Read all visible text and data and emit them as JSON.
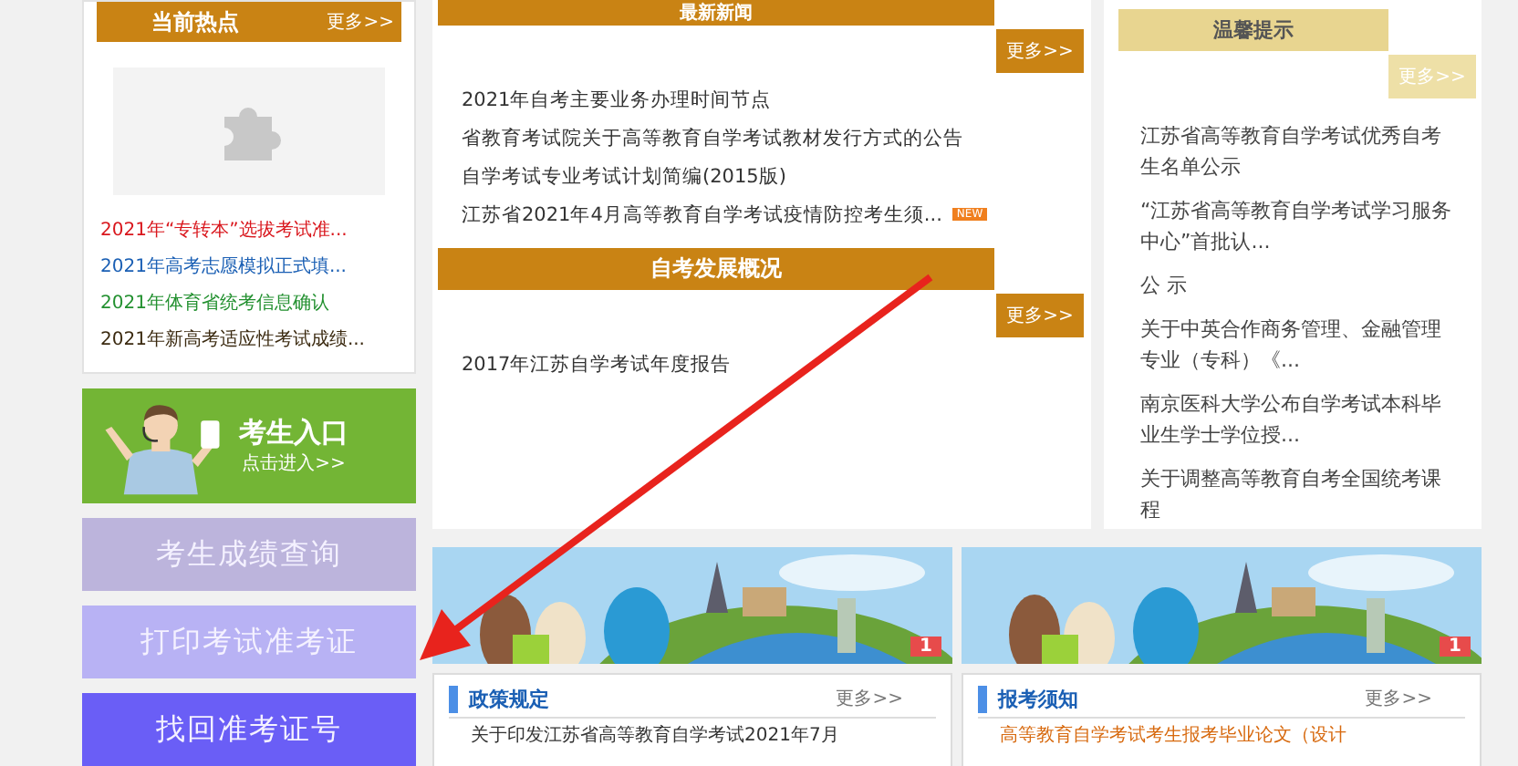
{
  "hot": {
    "title": "当前热点",
    "more": "更多>>",
    "items": [
      {
        "text": "2021年“专转本”选拔考试准...",
        "color": "#d9161c"
      },
      {
        "text": "2021年高考志愿模拟正式填...",
        "color": "#1a5fb4"
      },
      {
        "text": "2021年体育省统考信息确认",
        "color": "#22902f"
      },
      {
        "text": "2021年新高考适应性考试成绩...",
        "color": "#3b2a10"
      }
    ]
  },
  "entrance": {
    "title": "考生入口",
    "subtitle": "点击进入>>"
  },
  "quick_buttons": [
    {
      "label": "考生成绩查询",
      "color": "#bcb4dc"
    },
    {
      "label": "打印考试准考证",
      "color": "#b8b2f4"
    },
    {
      "label": "找回准考证号",
      "color": "#6a5ef6"
    }
  ],
  "news": {
    "title": "最新新闻",
    "more": "更多>>",
    "items": [
      {
        "text": "2021年自考主要业务办理时间节点"
      },
      {
        "text": "省教育考试院关于高等教育自学考试教材发行方式的公告"
      },
      {
        "text": "自学考试专业考试计划简编(2015版)"
      },
      {
        "text": "江苏省2021年4月高等教育自学考试疫情防控考生须...",
        "badge": "NEW"
      }
    ]
  },
  "development": {
    "title": "自考发展概况",
    "more": "更多>>",
    "items": [
      {
        "text": "2017年江苏自学考试年度报告"
      }
    ]
  },
  "tips": {
    "title": "温馨提示",
    "more": "更多>>",
    "items": [
      {
        "text": "江苏省高等教育自学考试优秀自考生名单公示"
      },
      {
        "text": "“江苏省高等教育自学考试学习服务中心”首批认..."
      },
      {
        "text": "公 示"
      },
      {
        "text": "关于中英合作商务管理、金融管理专业（专科）《..."
      },
      {
        "text": "南京医科大学公布自学考试本科毕业生学士学位授..."
      },
      {
        "text": "关于调整高等教育自考全国统考课程"
      }
    ]
  },
  "banners": [
    {
      "kind": "picture",
      "badge": "1"
    },
    {
      "kind": "picture",
      "badge": "1"
    }
  ],
  "policy": {
    "title": "政策规定",
    "more": "更多>>",
    "items": [
      {
        "text": "关于印发江苏省高等教育自学考试2021年7月"
      }
    ]
  },
  "notice": {
    "title": "报考须知",
    "more": "更多>>",
    "items": [
      {
        "text": "高等教育自学考试考生报考毕业论文（设计"
      }
    ]
  }
}
